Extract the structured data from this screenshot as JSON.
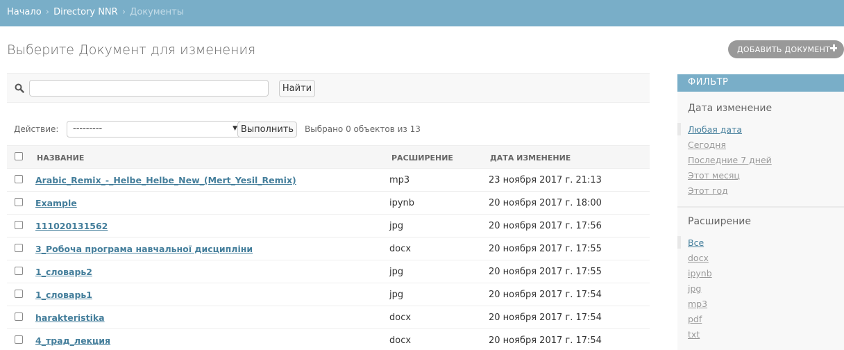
{
  "breadcrumbs": {
    "home": "Начало",
    "app": "Directory NNR",
    "current": "Документы",
    "separator": "›"
  },
  "page": {
    "title": "Выберите Документ для изменения"
  },
  "add_button": {
    "label": "ДОБАВИТЬ ДОКУМЕНТ"
  },
  "search": {
    "value": "",
    "button": "Найти"
  },
  "actions": {
    "label": "Действие:",
    "selected": "---------",
    "go_button": "Выполнить",
    "counter": "Выбрано 0 объектов из 13"
  },
  "table": {
    "headers": {
      "name": "НАЗВАНИЕ",
      "ext": "РАСШИРЕНИЕ",
      "date": "ДАТА ИЗМЕНЕНИЕ"
    },
    "rows": [
      {
        "name": "Arabic_Remix_-_Helbe_Helbe_New_(Mert_Yesil_Remix)",
        "ext": "mp3",
        "date": "23 ноября 2017 г. 21:13"
      },
      {
        "name": "Example",
        "ext": "ipynb",
        "date": "20 ноября 2017 г. 18:00"
      },
      {
        "name": "111020131562",
        "ext": "jpg",
        "date": "20 ноября 2017 г. 17:56"
      },
      {
        "name": "3_Робоча програма навчальної дисципліни",
        "ext": "docx",
        "date": "20 ноября 2017 г. 17:55"
      },
      {
        "name": "1_словарь2",
        "ext": "jpg",
        "date": "20 ноября 2017 г. 17:55"
      },
      {
        "name": "1_словарь1",
        "ext": "jpg",
        "date": "20 ноября 2017 г. 17:54"
      },
      {
        "name": "harakteristika",
        "ext": "docx",
        "date": "20 ноября 2017 г. 17:54"
      },
      {
        "name": "4_трад_лекция",
        "ext": "docx",
        "date": "20 ноября 2017 г. 17:54"
      }
    ]
  },
  "filter": {
    "title": "ФИЛЬТР",
    "date_title": "Дата изменение",
    "date_options": [
      "Любая дата",
      "Сегодня",
      "Последние 7 дней",
      "Этот месяц",
      "Этот год"
    ],
    "ext_title": "Расширение",
    "ext_options": [
      "Все",
      "docx",
      "ipynb",
      "jpg",
      "mp3",
      "pdf",
      "txt"
    ]
  }
}
